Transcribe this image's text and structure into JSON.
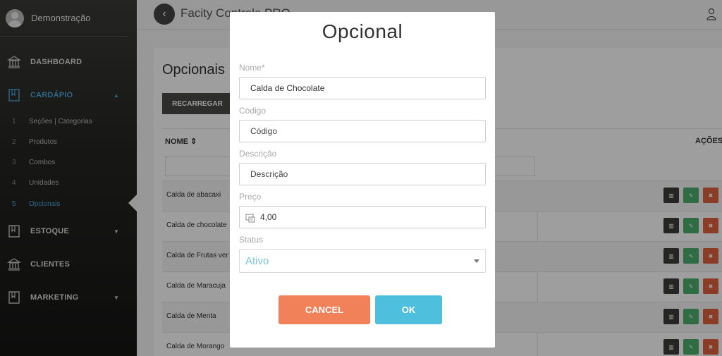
{
  "sidebar": {
    "user_name": "Demonstração",
    "menu": [
      {
        "label": "DASHBOARD",
        "icon": "bank-icon"
      },
      {
        "label": "CARDÁPIO",
        "icon": "book-icon",
        "expanded": true
      },
      {
        "label": "ESTOQUE",
        "icon": "book-icon"
      },
      {
        "label": "CLIENTES",
        "icon": "bank-icon"
      },
      {
        "label": "MARKETING",
        "icon": "book-icon"
      }
    ],
    "submenu": [
      {
        "num": "1",
        "label": "Seções | Categorias"
      },
      {
        "num": "2",
        "label": "Produtos"
      },
      {
        "num": "3",
        "label": "Combos"
      },
      {
        "num": "4",
        "label": "Unidades"
      },
      {
        "num": "5",
        "label": "Opcionais",
        "active": true
      }
    ],
    "accent_color": "#4aa8d8"
  },
  "topbar": {
    "title": "Facity Controle PRO"
  },
  "page": {
    "title": "Opcionais",
    "reload_label": "RECARREGAR",
    "columns": {
      "name": "NOME ⇕",
      "actions": "AÇÕES"
    },
    "rows": [
      {
        "name": "Calda de abacaxi"
      },
      {
        "name": "Calda de chocolate"
      },
      {
        "name": "Calda de Frutas ver"
      },
      {
        "name": "Calda de Maracuja"
      },
      {
        "name": "Calda de Menta"
      },
      {
        "name": "Calda de Morango"
      }
    ],
    "action_icons": [
      "barcode-icon",
      "edit-icon",
      "delete-icon"
    ]
  },
  "modal": {
    "title": "Opcional",
    "fields": {
      "nome": {
        "label": "Nome*",
        "value": "Calda de Chocolate"
      },
      "codigo": {
        "label": "Código",
        "placeholder": "Código"
      },
      "descricao": {
        "label": "Descrição",
        "placeholder": "Descrição"
      },
      "preco": {
        "label": "Preço",
        "value": "4,00"
      },
      "status": {
        "label": "Status",
        "value": "Ativo"
      }
    },
    "cancel_label": "CANCEL",
    "ok_label": "OK",
    "cancel_color": "#f08158",
    "ok_color": "#4ec0dd"
  }
}
